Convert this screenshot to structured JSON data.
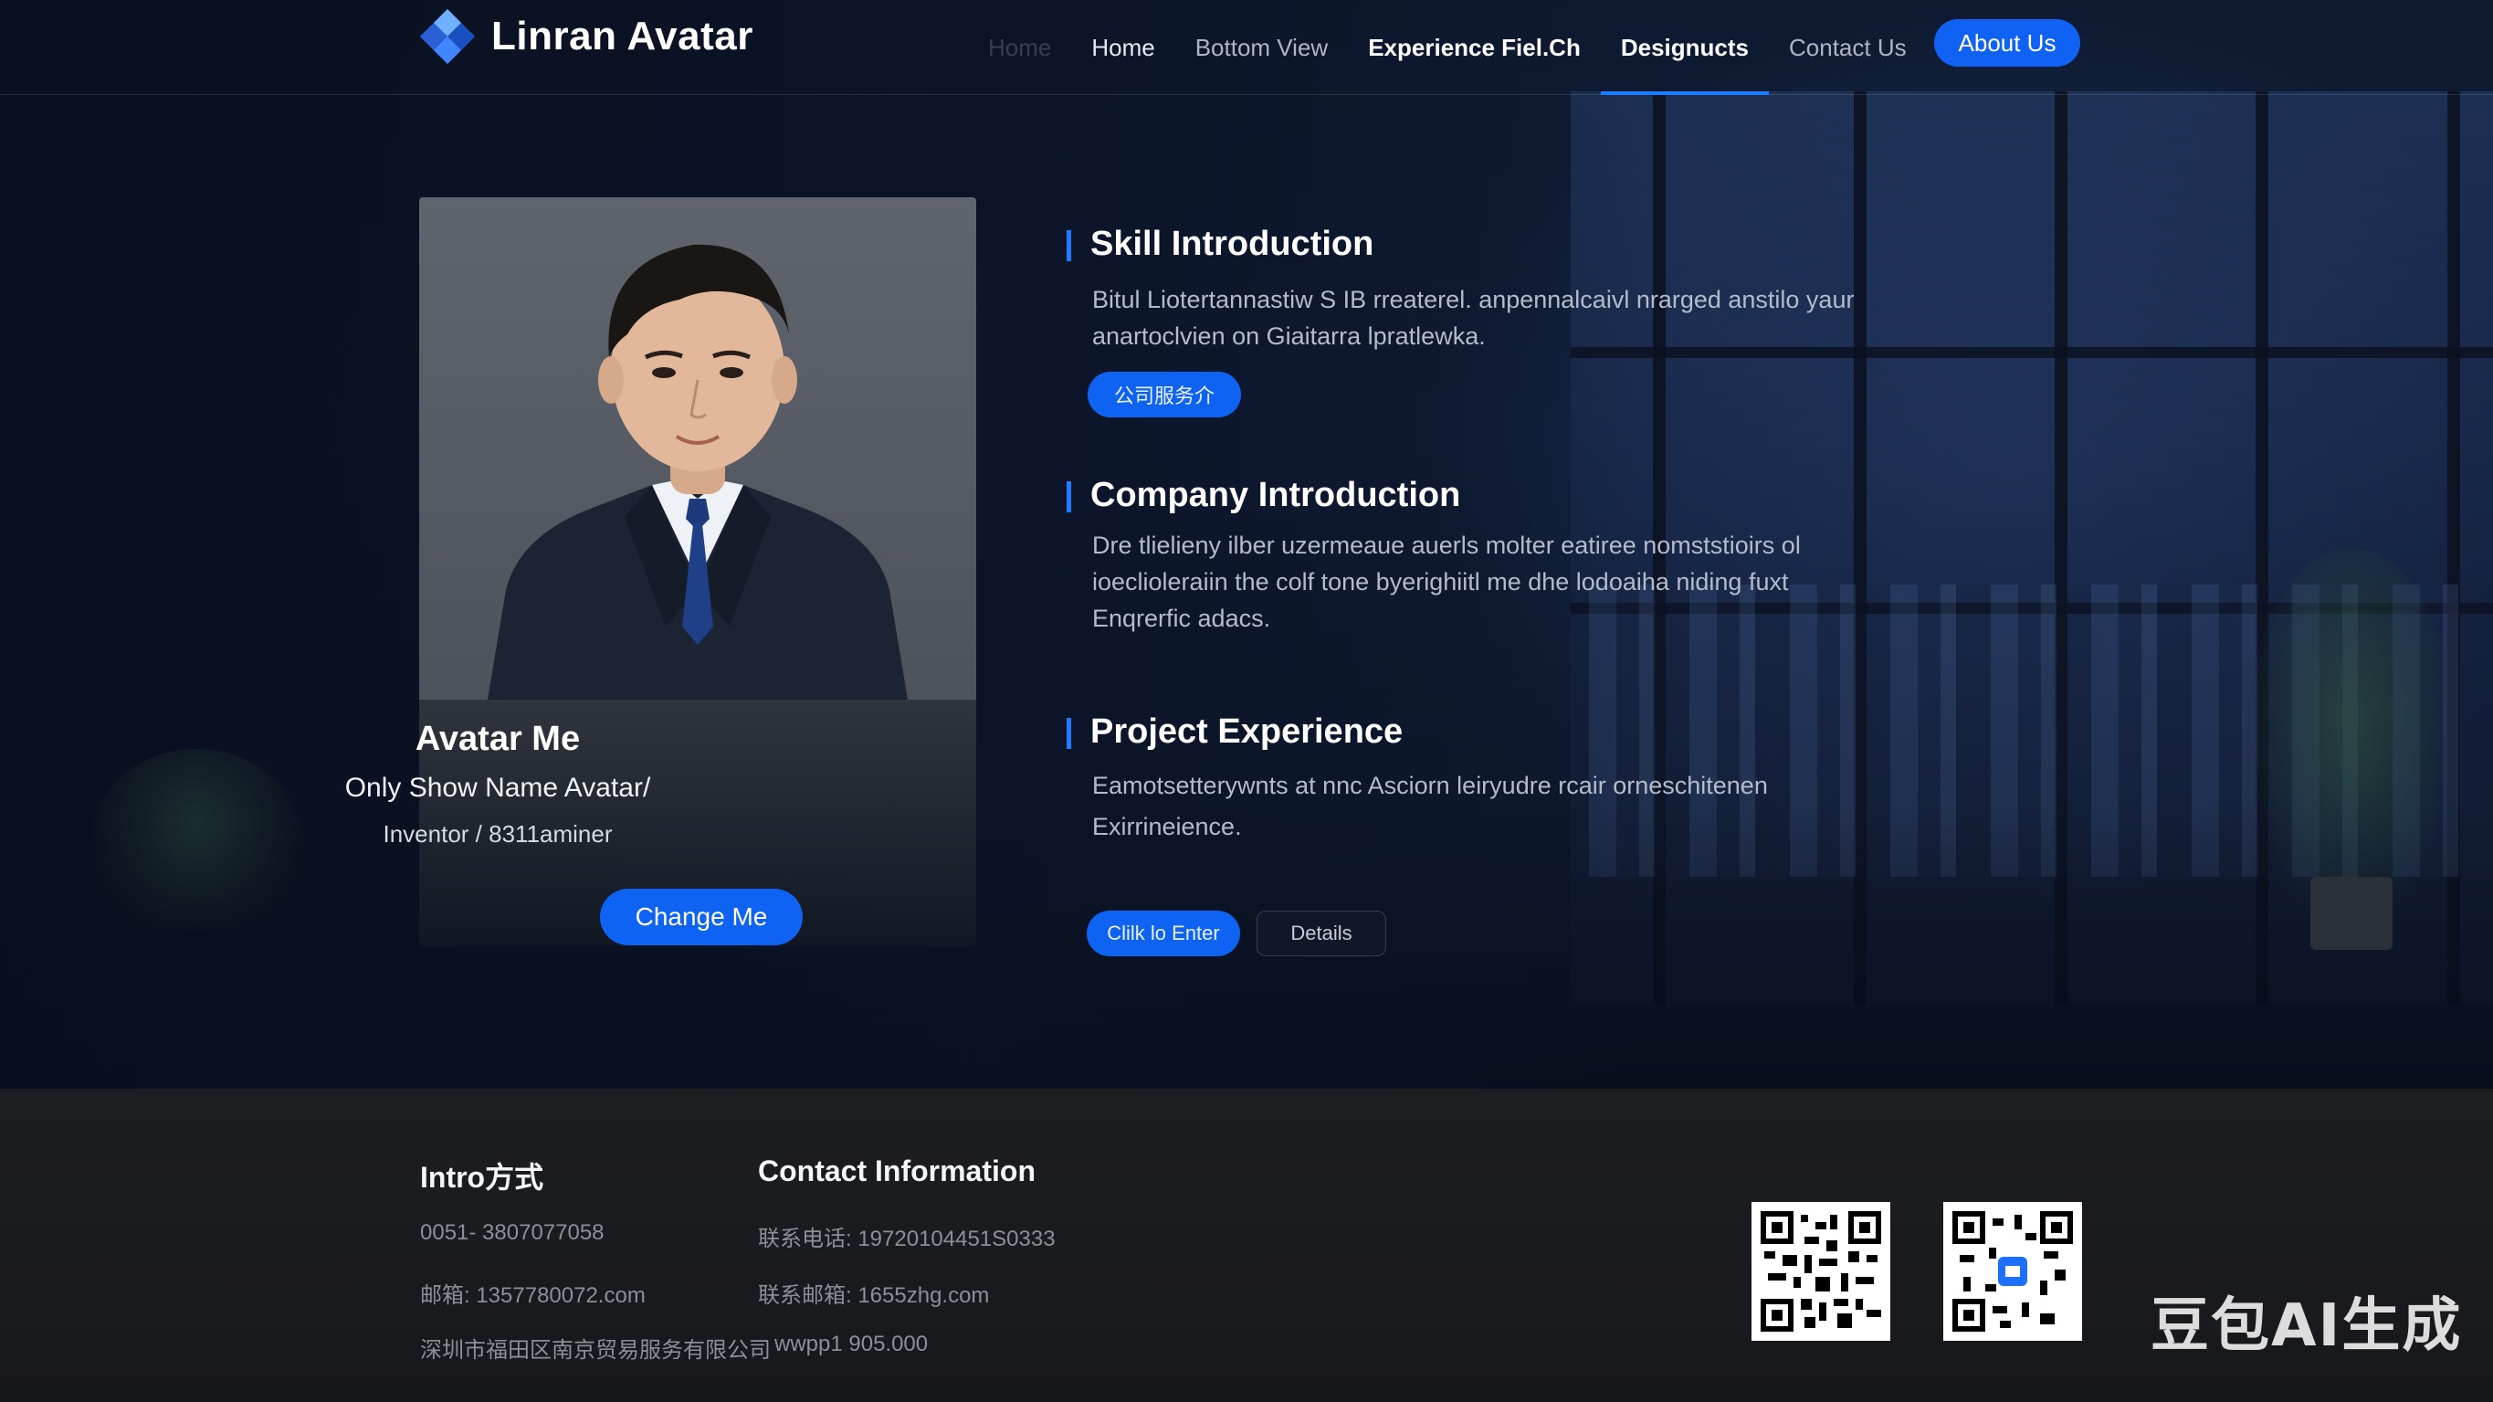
{
  "brand": {
    "name": "Linran Avatar",
    "logo_icon": "diamond-logo-icon",
    "accent": "#1062f5"
  },
  "nav": {
    "items": [
      {
        "label": "Home",
        "state": "dim"
      },
      {
        "label": "Home",
        "state": "normal"
      },
      {
        "label": "Bottom View",
        "state": "muted"
      },
      {
        "label": "Experience Fiel.Ch",
        "state": "bold"
      },
      {
        "label": "Designucts",
        "state": "active"
      },
      {
        "label": "Contact Us",
        "state": "muted"
      }
    ],
    "cta_label": "About Us"
  },
  "profile": {
    "name": "Avatar Me",
    "subtitle": "Only Show Name Avatar/",
    "role": "Inventor  /  8311aminer",
    "button_label": "Change Me"
  },
  "sections": {
    "skill": {
      "title": "Skill Introduction",
      "text_1": "Bitul Liotertannastiw S IB rreaterel. anpennalcaivl nrarged anstilo yaur",
      "text_2": "anartoclvien on Giaitarra lpratlewka.",
      "button_label": "公司服务介"
    },
    "company": {
      "title": "Company Introduction",
      "text_1": "Dre tlielieny ilber uzermeaue  auerls molter eatiree nomststioirs ol",
      "text_2": "ioeclioleraiin the  colf tone  byerighiitl me dhe lodoaiha niding fuxt",
      "text_3": "Enqrerfic adacs."
    },
    "project": {
      "title": "Project Experience",
      "text_1": "Eamotsetterywnts at nnc Asciorn leiryudre rcair orneschitenen",
      "text_2": "Exirrineience.",
      "button_primary": "Clilk lo Enter",
      "button_secondary": "Details"
    }
  },
  "footer": {
    "col1": {
      "heading": "Intro方式",
      "line_1": "0051- 3807077058",
      "line_2": "邮箱: 1357780072.com",
      "line_3": "深圳市福田区南京贸易服务有限公司"
    },
    "col2": {
      "heading": "Contact Information",
      "line_1": "联系电话: 19720104451S0333",
      "line_2": "联系邮箱: 1655zhg.com",
      "line_3": "wwpp1 905.000"
    },
    "qr_icons": [
      "qr-code-icon",
      "qr-code-icon"
    ]
  },
  "watermark": "豆包AI生成"
}
